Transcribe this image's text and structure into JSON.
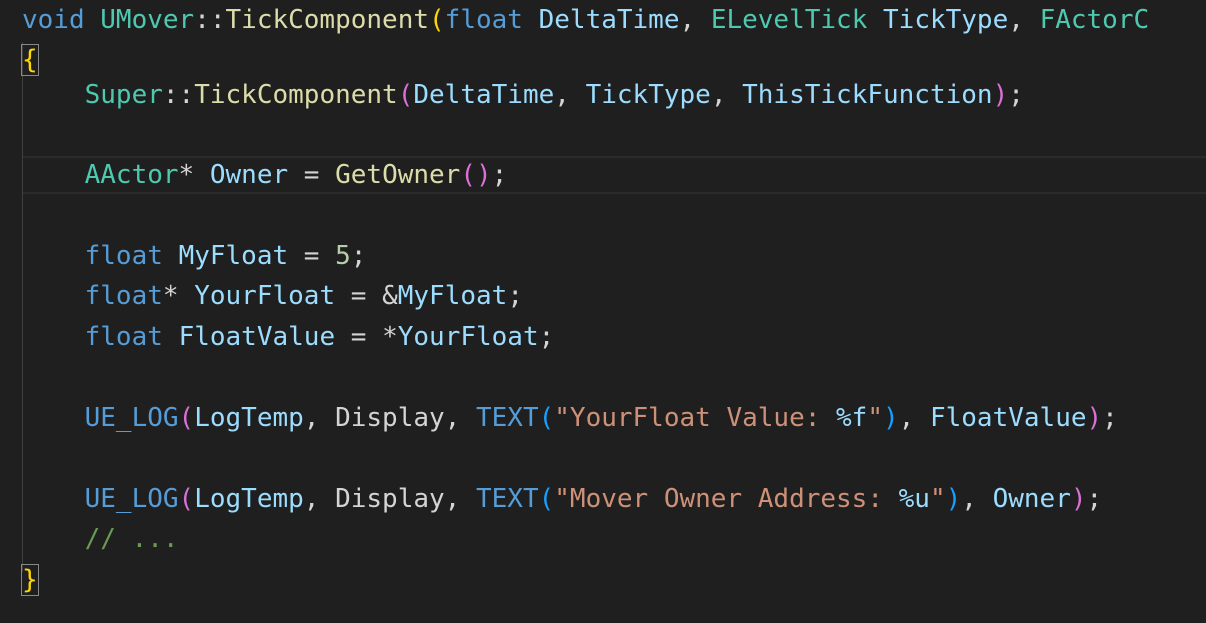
{
  "editor": {
    "theme": {
      "background": "#1f1f1f",
      "keyword": "#569cd6",
      "type": "#4ec9b0",
      "function": "#dcdcaa",
      "variable": "#9cdcfe",
      "string": "#ce9178",
      "number": "#b5cea8",
      "comment": "#6a9955",
      "bracket_level1": "#ffd700",
      "bracket_level2": "#da70d6",
      "bracket_level3": "#179fff"
    },
    "lines": [
      {
        "tokens": [
          {
            "t": "void",
            "c": "keyword"
          },
          {
            "t": " ",
            "c": "punct"
          },
          {
            "t": "UMover",
            "c": "type"
          },
          {
            "t": "::",
            "c": "punct"
          },
          {
            "t": "TickComponent",
            "c": "func"
          },
          {
            "t": "(",
            "c": "paren1"
          },
          {
            "t": "float",
            "c": "keyword"
          },
          {
            "t": " ",
            "c": "punct"
          },
          {
            "t": "DeltaTime",
            "c": "var"
          },
          {
            "t": ", ",
            "c": "punct"
          },
          {
            "t": "ELevelTick",
            "c": "type"
          },
          {
            "t": " ",
            "c": "punct"
          },
          {
            "t": "TickType",
            "c": "var"
          },
          {
            "t": ", ",
            "c": "punct"
          },
          {
            "t": "FActorC",
            "c": "type"
          }
        ]
      },
      {
        "tokens": [
          {
            "t": "{",
            "c": "brace"
          }
        ]
      },
      {
        "tokens": [
          {
            "t": "    ",
            "c": "punct"
          },
          {
            "t": "Super",
            "c": "type"
          },
          {
            "t": "::",
            "c": "punct"
          },
          {
            "t": "TickComponent",
            "c": "func"
          },
          {
            "t": "(",
            "c": "paren2"
          },
          {
            "t": "DeltaTime",
            "c": "var"
          },
          {
            "t": ", ",
            "c": "punct"
          },
          {
            "t": "TickType",
            "c": "var"
          },
          {
            "t": ", ",
            "c": "punct"
          },
          {
            "t": "ThisTickFunction",
            "c": "var"
          },
          {
            "t": ")",
            "c": "paren2"
          },
          {
            "t": ";",
            "c": "punct"
          }
        ]
      },
      {
        "tokens": []
      },
      {
        "tokens": [
          {
            "t": "    ",
            "c": "punct"
          },
          {
            "t": "AActor",
            "c": "type"
          },
          {
            "t": "* ",
            "c": "punct"
          },
          {
            "t": "Owner",
            "c": "var"
          },
          {
            "t": " = ",
            "c": "punct"
          },
          {
            "t": "GetOwner",
            "c": "func"
          },
          {
            "t": "()",
            "c": "paren2"
          },
          {
            "t": ";",
            "c": "punct"
          }
        ]
      },
      {
        "tokens": []
      },
      {
        "tokens": [
          {
            "t": "    ",
            "c": "punct"
          },
          {
            "t": "float",
            "c": "keyword"
          },
          {
            "t": " ",
            "c": "punct"
          },
          {
            "t": "MyFloat",
            "c": "var"
          },
          {
            "t": " = ",
            "c": "punct"
          },
          {
            "t": "5",
            "c": "num"
          },
          {
            "t": ";",
            "c": "punct"
          }
        ]
      },
      {
        "tokens": [
          {
            "t": "    ",
            "c": "punct"
          },
          {
            "t": "float",
            "c": "keyword"
          },
          {
            "t": "* ",
            "c": "punct"
          },
          {
            "t": "YourFloat",
            "c": "var"
          },
          {
            "t": " = &",
            "c": "punct"
          },
          {
            "t": "MyFloat",
            "c": "var"
          },
          {
            "t": ";",
            "c": "punct"
          }
        ]
      },
      {
        "tokens": [
          {
            "t": "    ",
            "c": "punct"
          },
          {
            "t": "float",
            "c": "keyword"
          },
          {
            "t": " ",
            "c": "punct"
          },
          {
            "t": "FloatValue",
            "c": "var"
          },
          {
            "t": " = *",
            "c": "punct"
          },
          {
            "t": "YourFloat",
            "c": "var"
          },
          {
            "t": ";",
            "c": "punct"
          }
        ]
      },
      {
        "tokens": []
      },
      {
        "tokens": [
          {
            "t": "    ",
            "c": "punct"
          },
          {
            "t": "UE_LOG",
            "c": "macro"
          },
          {
            "t": "(",
            "c": "paren2"
          },
          {
            "t": "LogTemp",
            "c": "var"
          },
          {
            "t": ", ",
            "c": "punct"
          },
          {
            "t": "Display",
            "c": "punct"
          },
          {
            "t": ", ",
            "c": "punct"
          },
          {
            "t": "TEXT",
            "c": "macro"
          },
          {
            "t": "(",
            "c": "paren3"
          },
          {
            "t": "\"YourFloat Value: ",
            "c": "string"
          },
          {
            "t": "%f",
            "c": "fmt"
          },
          {
            "t": "\"",
            "c": "string"
          },
          {
            "t": ")",
            "c": "paren3"
          },
          {
            "t": ", ",
            "c": "punct"
          },
          {
            "t": "FloatValue",
            "c": "var"
          },
          {
            "t": ")",
            "c": "paren2"
          },
          {
            "t": ";",
            "c": "punct"
          }
        ]
      },
      {
        "tokens": []
      },
      {
        "tokens": [
          {
            "t": "    ",
            "c": "punct"
          },
          {
            "t": "UE_LOG",
            "c": "macro"
          },
          {
            "t": "(",
            "c": "paren2"
          },
          {
            "t": "LogTemp",
            "c": "var"
          },
          {
            "t": ", ",
            "c": "punct"
          },
          {
            "t": "Display",
            "c": "punct"
          },
          {
            "t": ", ",
            "c": "punct"
          },
          {
            "t": "TEXT",
            "c": "macro"
          },
          {
            "t": "(",
            "c": "paren3"
          },
          {
            "t": "\"Mover Owner Address: ",
            "c": "string"
          },
          {
            "t": "%u",
            "c": "fmt"
          },
          {
            "t": "\"",
            "c": "string"
          },
          {
            "t": ")",
            "c": "paren3"
          },
          {
            "t": ", ",
            "c": "punct"
          },
          {
            "t": "Owner",
            "c": "var"
          },
          {
            "t": ")",
            "c": "paren2"
          },
          {
            "t": ";",
            "c": "punct"
          }
        ]
      },
      {
        "tokens": [
          {
            "t": "    ",
            "c": "punct"
          },
          {
            "t": "// ...",
            "c": "comment"
          }
        ]
      },
      {
        "tokens": [
          {
            "t": "}",
            "c": "brace"
          }
        ]
      }
    ]
  }
}
